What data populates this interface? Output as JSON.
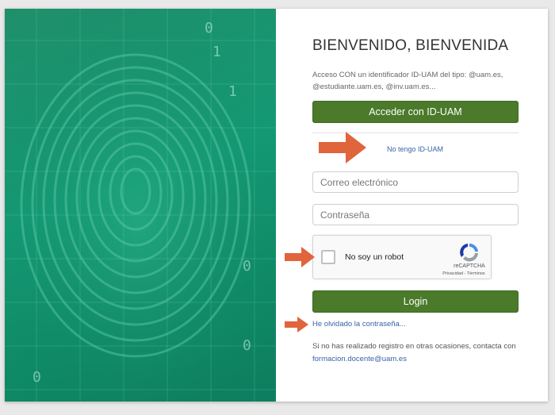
{
  "login": {
    "title": "BIENVENIDO, BIENVENIDA",
    "intro": "Acceso CON un identificador ID-UAM del tipo: @uam.es, @estudiante.uam.es, @inv.uam.es...",
    "id_uam_button": "Acceder con ID-UAM",
    "no_id_link": "No tengo ID-UAM",
    "email_placeholder": "Correo electrónico",
    "password_placeholder": "Contraseña",
    "login_button": "Login",
    "forgot_link": "He olvidado la contraseña...",
    "footer_text": "Si no has realizado registro en otras ocasiones, contacta con",
    "footer_email": "formacion.docente@uam.es"
  },
  "captcha": {
    "label": "No soy un robot",
    "brand": "reCAPTCHA",
    "links": "Privacidad - Términos"
  },
  "colors": {
    "button_green": "#4a7a2a",
    "panel_green": "#139a74",
    "link_blue": "#3a62a8",
    "arrow_orange": "#e0643c"
  }
}
